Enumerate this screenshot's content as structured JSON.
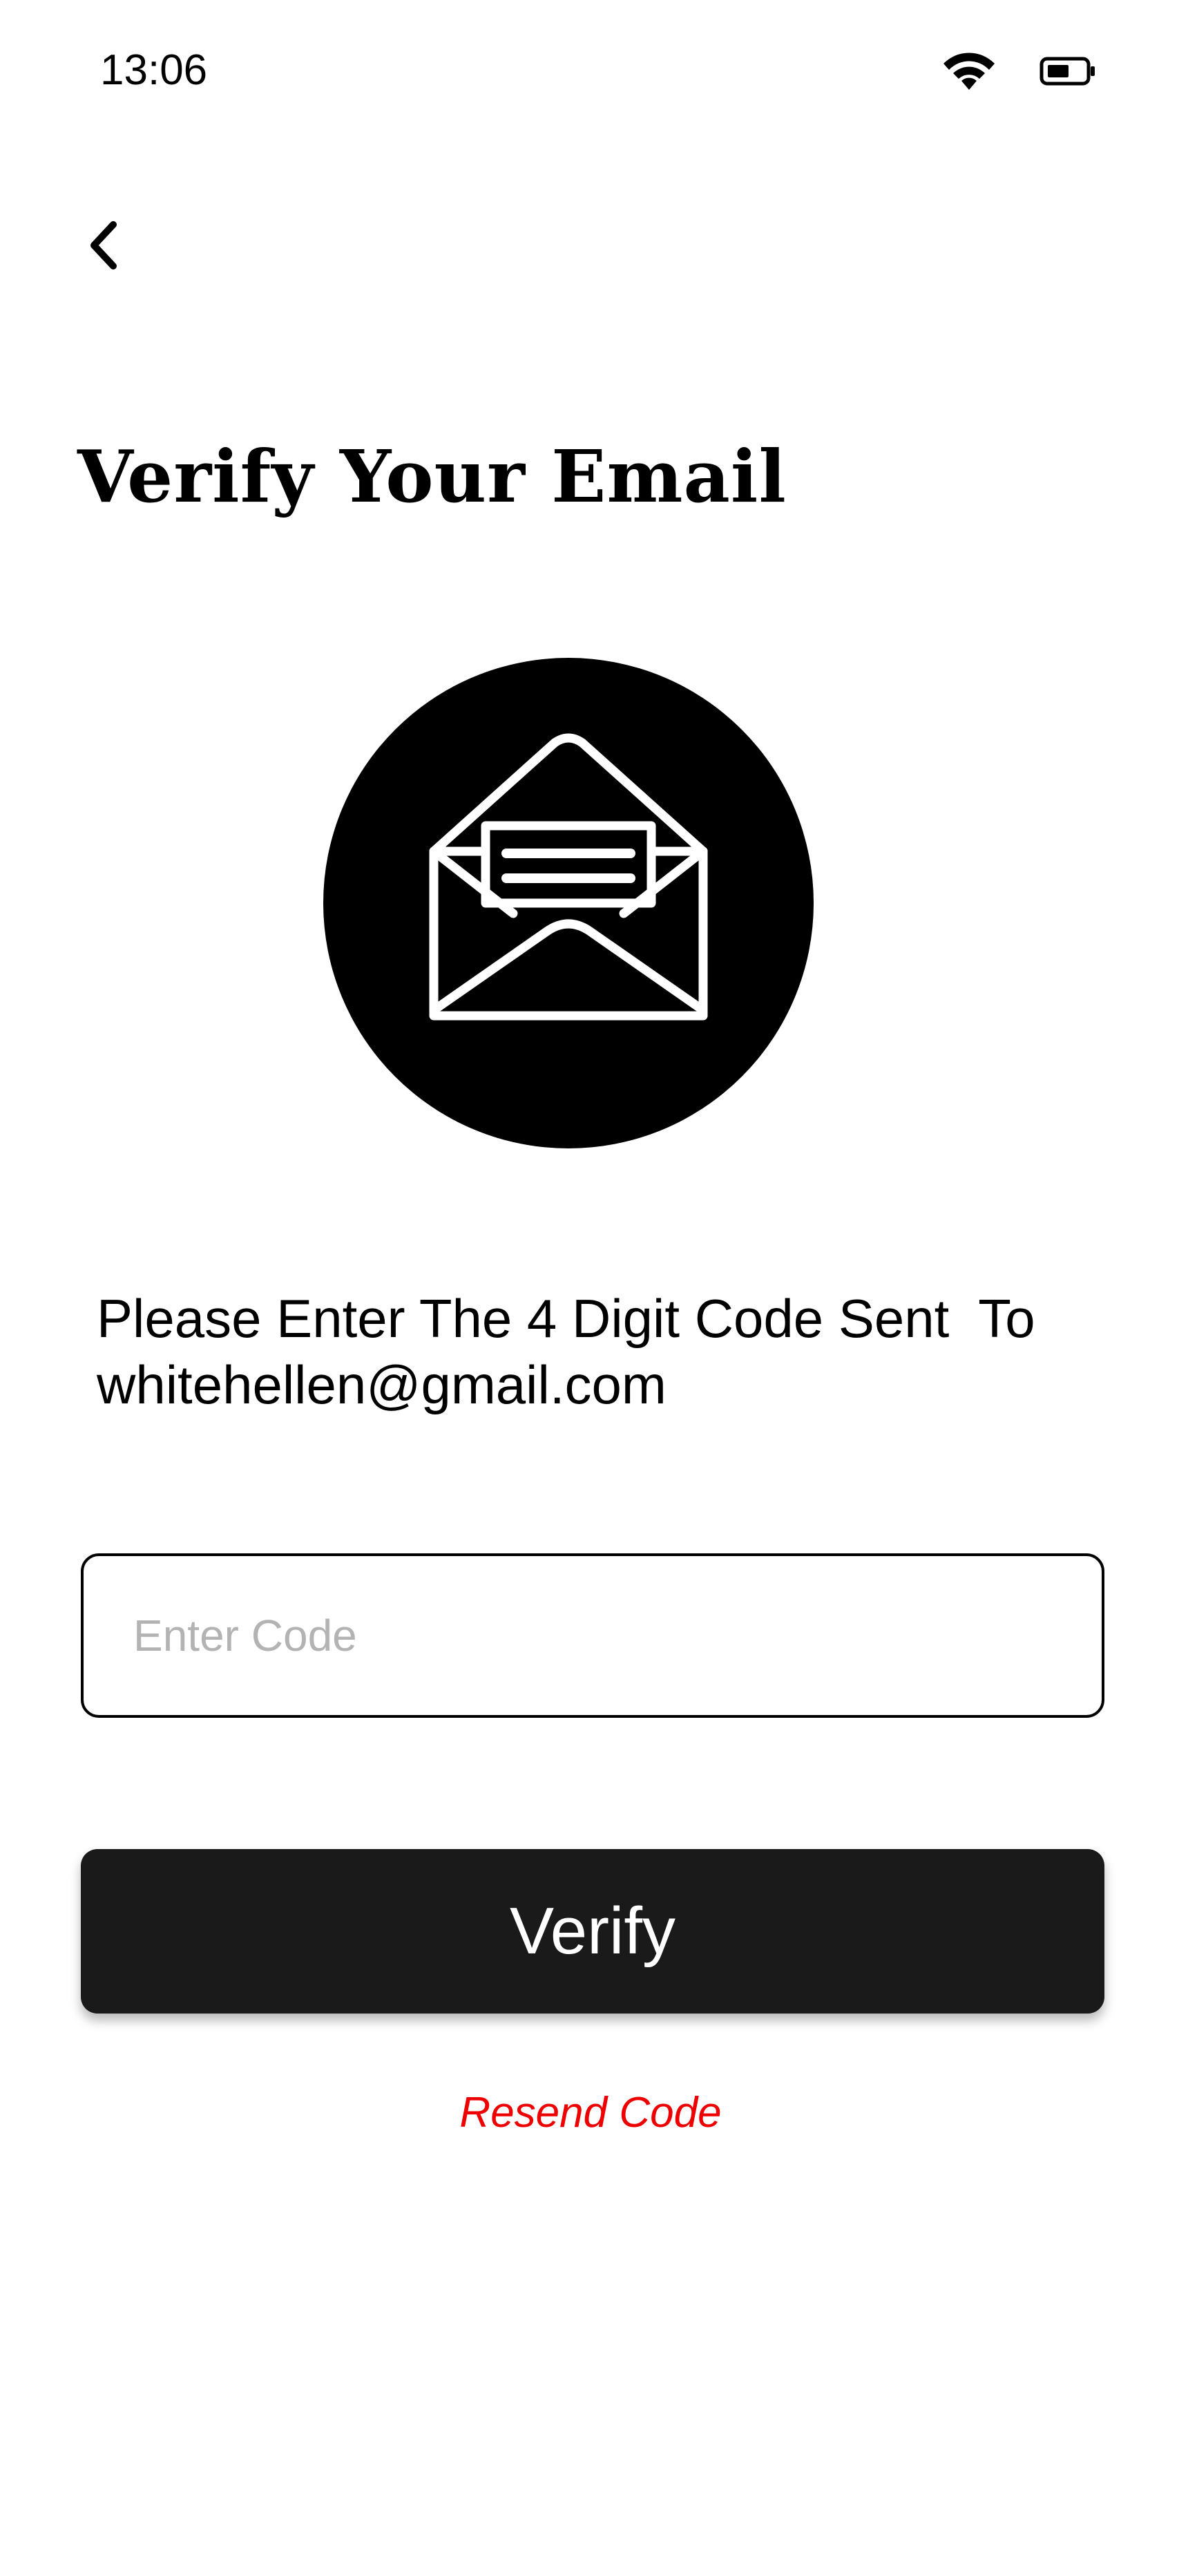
{
  "status_bar": {
    "time": "13:06",
    "wifi_icon": "wifi-icon",
    "battery_icon": "battery-icon"
  },
  "header": {
    "back_icon": "chevron-left-icon",
    "title": "Verify Your Email"
  },
  "illustration": {
    "icon": "open-envelope-icon",
    "circle_color": "#000000",
    "icon_color": "#ffffff"
  },
  "instructions": {
    "line1": "Please Enter The 4 Digit Code Sent  To",
    "line2": "whitehellen@gmail.com"
  },
  "code_field": {
    "value": "",
    "placeholder": "Enter Code"
  },
  "verify_button": {
    "label": "Verify",
    "background": "#1a1a1a",
    "text_color": "#ffffff"
  },
  "resend": {
    "label": "Resend Code",
    "color": "#ee0000"
  }
}
